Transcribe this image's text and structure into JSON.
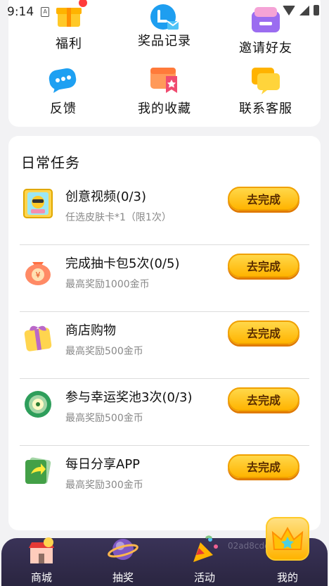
{
  "status_bar": {
    "time": "9:14",
    "sim_label": "A"
  },
  "top_grid": [
    {
      "label": "福利",
      "icon": "gift-icon"
    },
    {
      "label": "奖品记录",
      "icon": "prize-record-icon"
    },
    {
      "label": "邀请好友",
      "icon": "invite-friends-icon"
    },
    {
      "label": "反馈",
      "icon": "feedback-chat-icon"
    },
    {
      "label": "我的收藏",
      "icon": "favorites-icon"
    },
    {
      "label": "联系客服",
      "icon": "customer-service-icon"
    }
  ],
  "daily_tasks": {
    "title": "日常任务",
    "items": [
      {
        "name": "创意视频(0/3)",
        "sub": "任选皮肤卡*1（限1次）",
        "button": "去完成",
        "icon": "creative-video-icon"
      },
      {
        "name": "完成抽卡包5次(0/5)",
        "sub": "最高奖励1000金币",
        "button": "去完成",
        "icon": "money-bag-icon"
      },
      {
        "name": "商店购物",
        "sub": "最高奖励500金币",
        "button": "去完成",
        "icon": "shop-gift-icon"
      },
      {
        "name": "参与幸运奖池3次(0/3)",
        "sub": "最高奖励500金币",
        "button": "去完成",
        "icon": "lucky-pool-icon"
      },
      {
        "name": "每日分享APP",
        "sub": "最高奖励300金币",
        "button": "去完成",
        "icon": "share-icon"
      }
    ]
  },
  "bottom_nav": {
    "items": [
      {
        "label": "商城",
        "icon": "store-icon"
      },
      {
        "label": "抽奖",
        "icon": "planet-icon"
      },
      {
        "label": "活动",
        "icon": "party-popper-icon"
      },
      {
        "label": "我的",
        "icon": "crown-icon"
      }
    ],
    "watermark": "02ad8cdc"
  }
}
